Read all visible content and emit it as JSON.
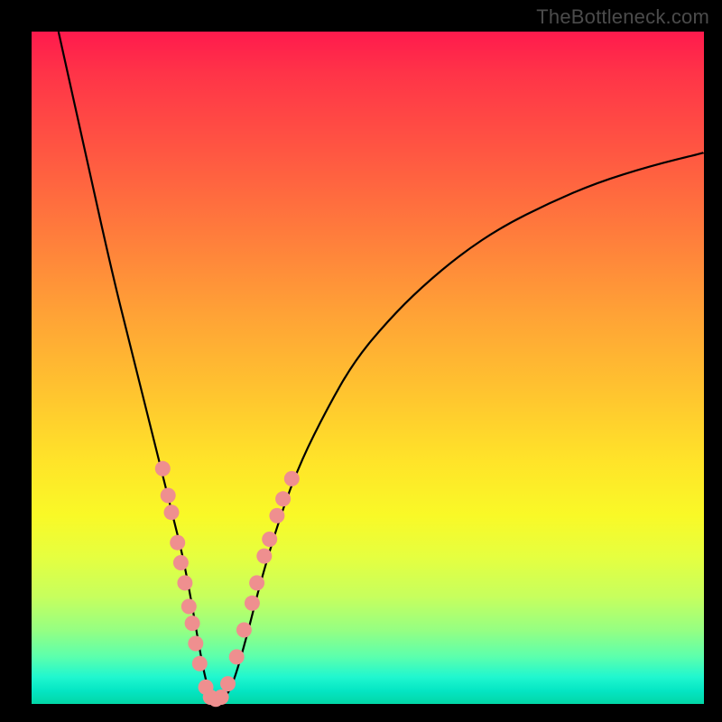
{
  "watermark": "TheBottleneck.com",
  "chart_data": {
    "type": "line",
    "title": "",
    "xlabel": "",
    "ylabel": "",
    "xlim": [
      0,
      100
    ],
    "ylim": [
      0,
      100
    ],
    "grid": false,
    "legend": false,
    "series": [
      {
        "name": "bottleneck-curve",
        "x": [
          4,
          8,
          12,
          15,
          17,
          19,
          21,
          22.5,
          24,
          25,
          26,
          27,
          28.5,
          30,
          32,
          34,
          37,
          40,
          44,
          48,
          53,
          58,
          64,
          70,
          77,
          84,
          92,
          100
        ],
        "y": [
          100,
          82,
          64,
          52,
          44,
          36,
          28,
          22,
          14,
          8,
          3,
          0.5,
          0.5,
          3,
          10,
          18,
          28,
          36,
          44,
          51,
          57,
          62,
          67,
          71,
          74.5,
          77.5,
          80,
          82
        ]
      }
    ],
    "markers": {
      "name": "highlight-points",
      "color": "#ef8f8f",
      "points": [
        {
          "x": 19.5,
          "y": 35
        },
        {
          "x": 20.3,
          "y": 31
        },
        {
          "x": 20.8,
          "y": 28.5
        },
        {
          "x": 21.7,
          "y": 24
        },
        {
          "x": 22.2,
          "y": 21
        },
        {
          "x": 22.8,
          "y": 18
        },
        {
          "x": 23.4,
          "y": 14.5
        },
        {
          "x": 23.9,
          "y": 12
        },
        {
          "x": 24.4,
          "y": 9
        },
        {
          "x": 25.0,
          "y": 6
        },
        {
          "x": 25.9,
          "y": 2.5
        },
        {
          "x": 26.6,
          "y": 1
        },
        {
          "x": 27.4,
          "y": 0.7
        },
        {
          "x": 28.2,
          "y": 1
        },
        {
          "x": 29.2,
          "y": 3
        },
        {
          "x": 30.5,
          "y": 7
        },
        {
          "x": 31.6,
          "y": 11
        },
        {
          "x": 32.8,
          "y": 15
        },
        {
          "x": 33.5,
          "y": 18
        },
        {
          "x": 34.6,
          "y": 22
        },
        {
          "x": 35.4,
          "y": 24.5
        },
        {
          "x": 36.5,
          "y": 28
        },
        {
          "x": 37.4,
          "y": 30.5
        },
        {
          "x": 38.7,
          "y": 33.5
        }
      ]
    },
    "background_gradient": {
      "top": "#ff1a4d",
      "mid": "#ffe429",
      "bottom": "#02d6a6"
    }
  }
}
